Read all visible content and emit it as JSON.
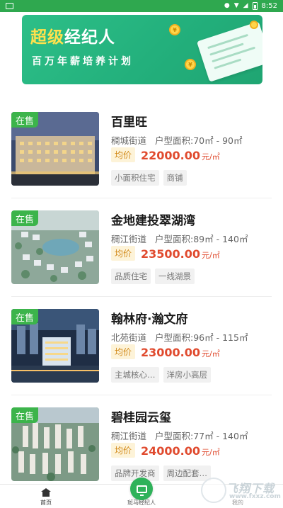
{
  "status_bar": {
    "time": "8:52"
  },
  "banner": {
    "title_highlight": "超级",
    "title_rest": "经纪人",
    "subtitle": "百万年薪培养计划"
  },
  "listings": [
    {
      "status": "在售",
      "name": "百里旺",
      "street": "稠城街道",
      "area": "户型面积:70㎡ - 90㎡",
      "avg_label": "均价",
      "price": "22000.00",
      "unit": "元/㎡",
      "tags": [
        "小面积住宅",
        "商铺"
      ]
    },
    {
      "status": "在售",
      "name": "金地建投翠湖湾",
      "street": "稠江街道",
      "area": "户型面积:89㎡ - 140㎡",
      "avg_label": "均价",
      "price": "23500.00",
      "unit": "元/㎡",
      "tags": [
        "品质住宅",
        "一线湖景"
      ]
    },
    {
      "status": "在售",
      "name": "翰林府·瀚文府",
      "street": "北苑街道",
      "area": "户型面积:96㎡ - 115㎡",
      "avg_label": "均价",
      "price": "23000.00",
      "unit": "元/㎡",
      "tags": [
        "主城核心…",
        "洋房小高层"
      ]
    },
    {
      "status": "在售",
      "name": "碧桂园云玺",
      "street": "稠江街道",
      "area": "户型面积:77㎡ - 140㎡",
      "avg_label": "均价",
      "price": "24000.00",
      "unit": "元/㎡",
      "tags": [
        "品牌开发商",
        "周边配套…"
      ]
    }
  ],
  "bottom_nav": {
    "home": "首页",
    "center": "斑马经纪人",
    "mine": "我的"
  },
  "watermark": {
    "text": "飞翔下载",
    "sub": "www.fxxz.com"
  },
  "colors": {
    "primary_green": "#2fa84f",
    "price_red": "#e04a2e",
    "badge_gold": "#d28a1a"
  }
}
